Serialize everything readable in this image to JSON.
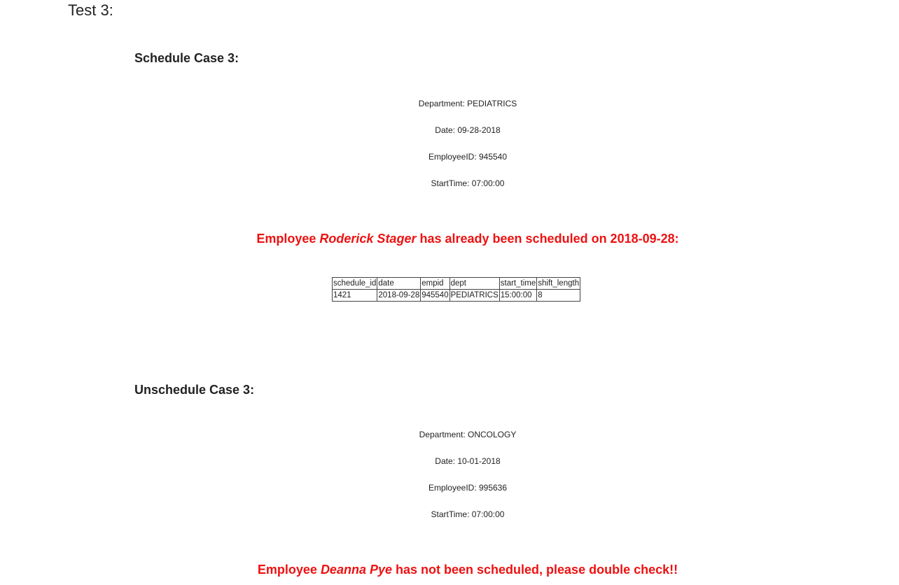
{
  "test_title": "Test 3:",
  "schedule_case": {
    "title": "Schedule Case 3:",
    "department": "Department: PEDIATRICS",
    "date": "Date: 09-28-2018",
    "employee_id": "EmployeeID: 945540",
    "start_time": "StartTime: 07:00:00",
    "alert": {
      "prefix": "Employee ",
      "name": "Roderick Stager",
      "suffix": " has already been scheduled on 2018-09-28:"
    },
    "table": {
      "headers": [
        "schedule_id",
        "date",
        "empid",
        "dept",
        "start_time",
        "shift_length"
      ],
      "rows": [
        [
          "1421",
          "2018-09-28",
          "945540",
          "PEDIATRICS",
          "15:00:00",
          "8"
        ]
      ]
    }
  },
  "unschedule_case": {
    "title": "Unschedule Case 3:",
    "department": "Department: ONCOLOGY",
    "date": "Date: 10-01-2018",
    "employee_id": "EmployeeID: 995636",
    "start_time": "StartTime: 07:00:00",
    "alert": {
      "prefix": "Employee ",
      "name": "Deanna Pye",
      "suffix": " has not been scheduled, please double check!!"
    }
  },
  "colors": {
    "alert": "#ee1111",
    "text": "#222222"
  }
}
